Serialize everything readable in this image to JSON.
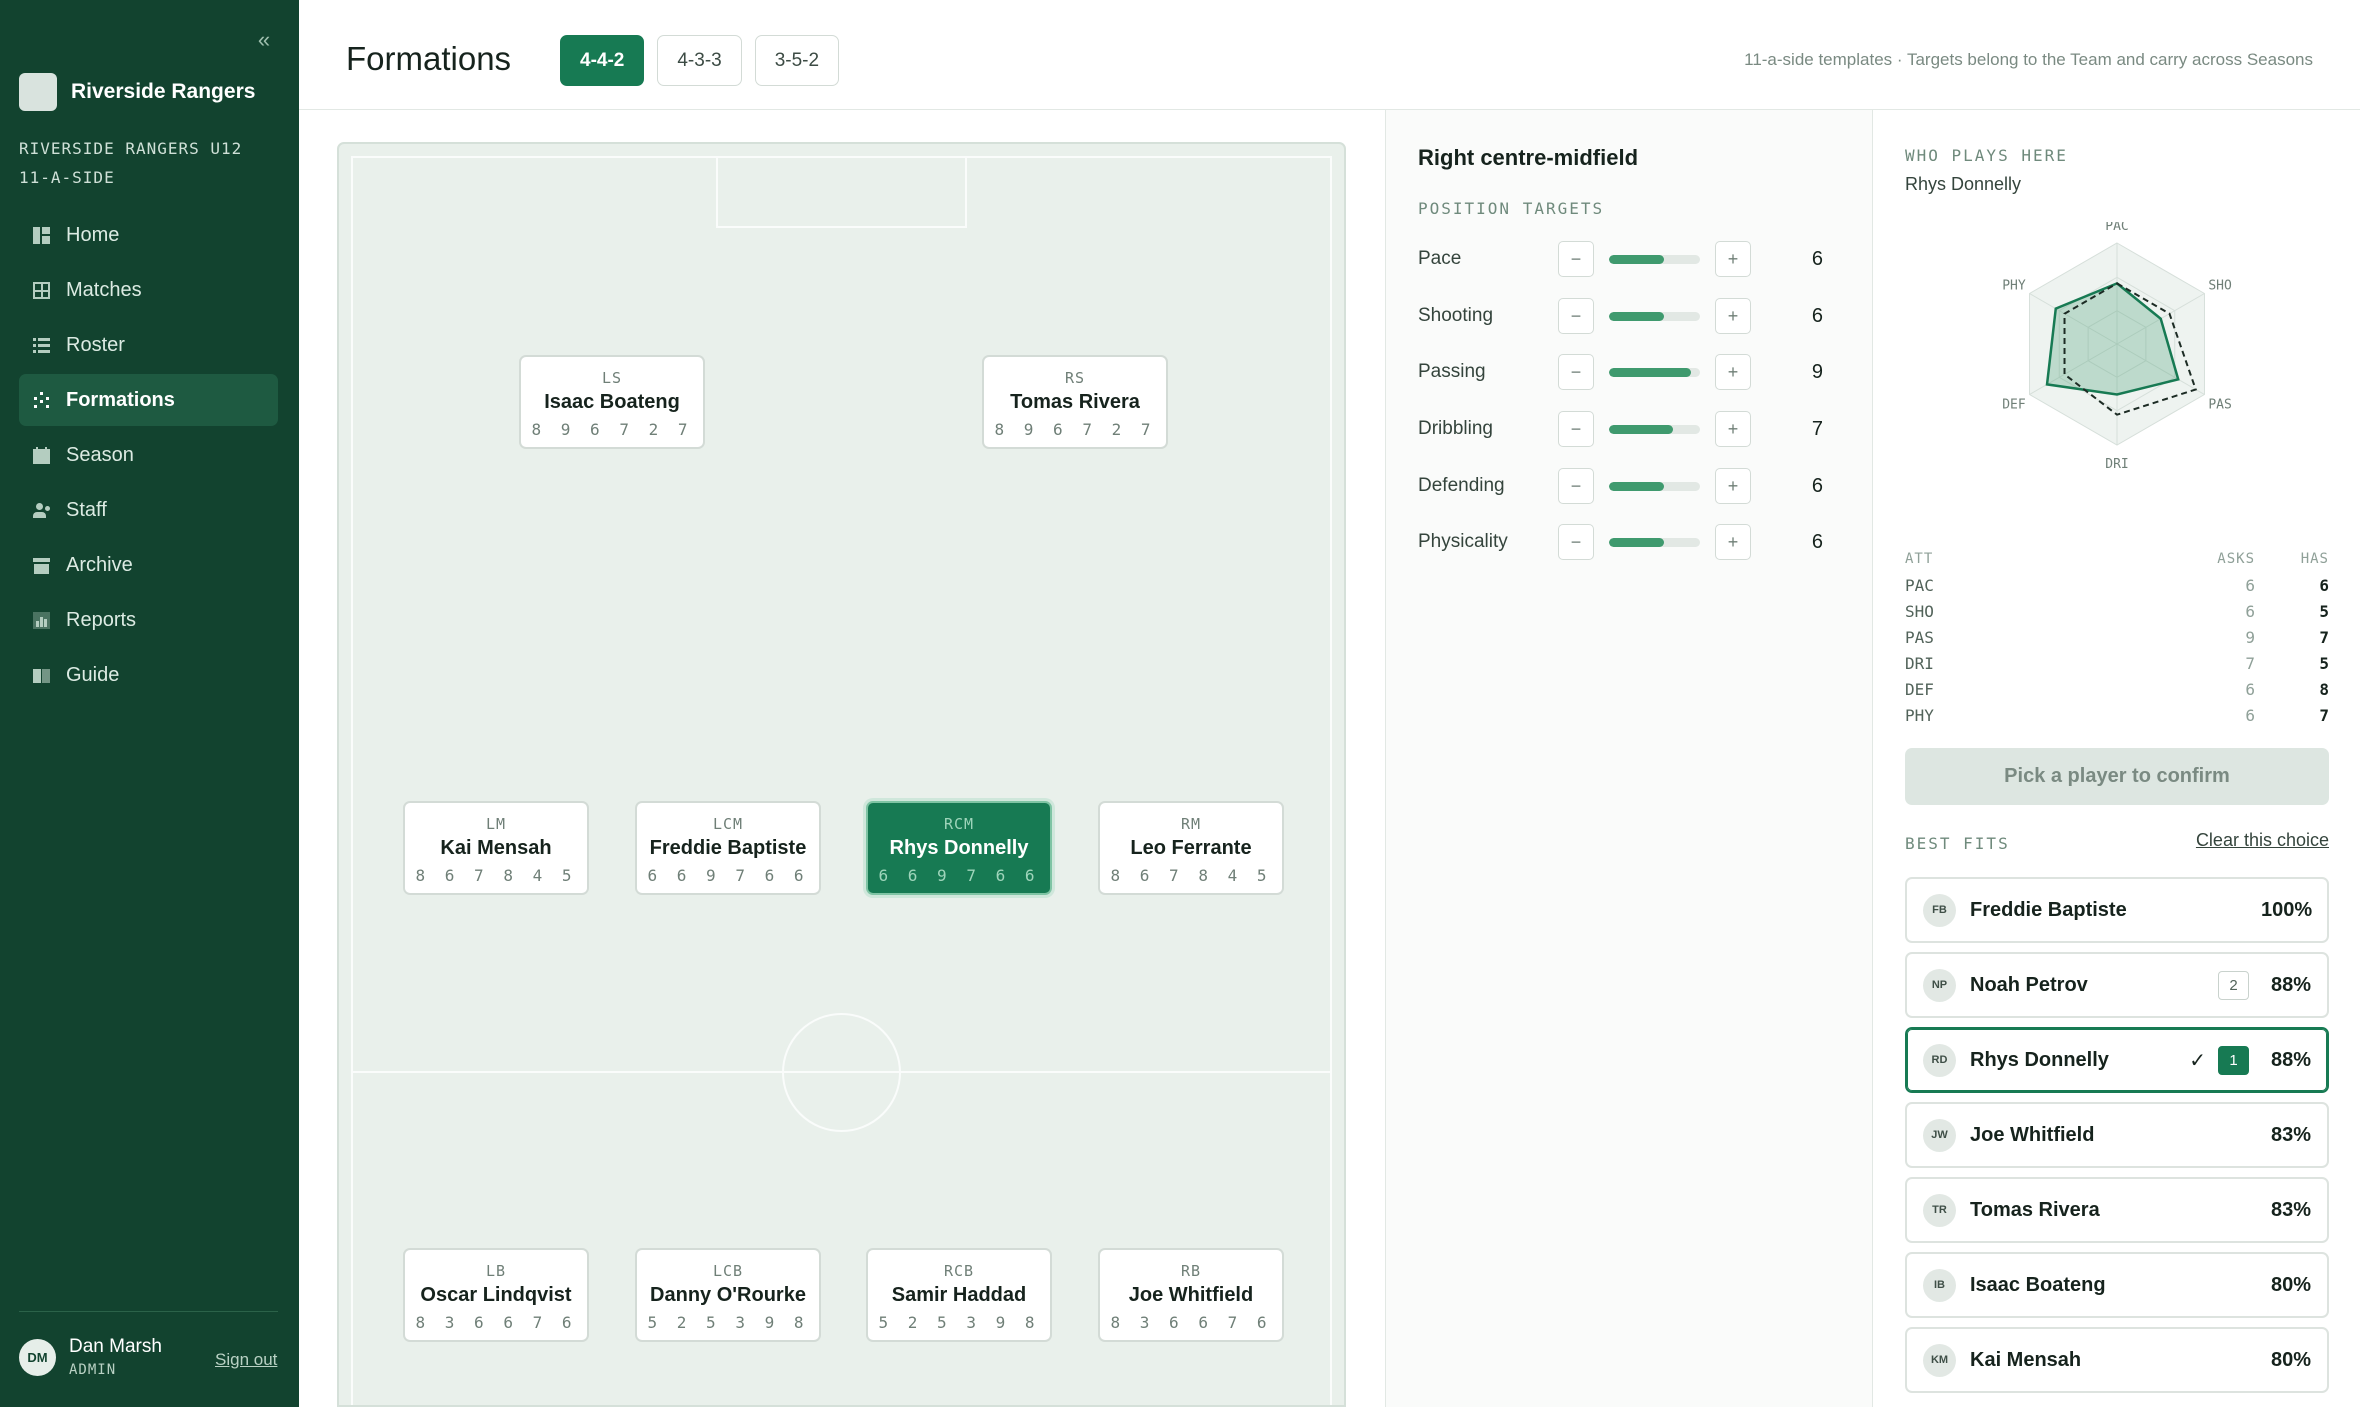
{
  "sidebar": {
    "collapse_icon": "double-chevron-left-icon",
    "brand_name": "Riverside Rangers",
    "team_line1": "RIVERSIDE RANGERS U12",
    "team_line2": "11-A-SIDE",
    "items": [
      {
        "label": "Home",
        "icon": "home-icon"
      },
      {
        "label": "Matches",
        "icon": "matches-icon"
      },
      {
        "label": "Roster",
        "icon": "roster-icon"
      },
      {
        "label": "Formations",
        "icon": "formations-icon",
        "active": true
      },
      {
        "label": "Season",
        "icon": "calendar-icon"
      },
      {
        "label": "Staff",
        "icon": "staff-icon"
      },
      {
        "label": "Archive",
        "icon": "archive-icon"
      },
      {
        "label": "Reports",
        "icon": "reports-icon"
      },
      {
        "label": "Guide",
        "icon": "guide-icon"
      }
    ],
    "user": {
      "initials": "DM",
      "name": "Dan Marsh",
      "role": "ADMIN",
      "signout": "Sign out"
    }
  },
  "header": {
    "title": "Formations",
    "tabs": [
      {
        "label": "4-4-2",
        "active": true
      },
      {
        "label": "4-3-3"
      },
      {
        "label": "3-5-2"
      }
    ],
    "note": "11-a-side templates · Targets belong to the Team and carry across Seasons"
  },
  "pitch": {
    "positions": [
      {
        "code": "LS",
        "name": "Isaac Boateng",
        "stats": "8 9 6 7 2 7"
      },
      {
        "code": "RS",
        "name": "Tomas Rivera",
        "stats": "8 9 6 7 2 7"
      },
      {
        "code": "LM",
        "name": "Kai Mensah",
        "stats": "8 6 7 8 4 5"
      },
      {
        "code": "LCM",
        "name": "Freddie Baptiste",
        "stats": "6 6 9 7 6 6"
      },
      {
        "code": "RCM",
        "name": "Rhys Donnelly",
        "stats": "6 6 9 7 6 6",
        "selected": true
      },
      {
        "code": "RM",
        "name": "Leo Ferrante",
        "stats": "8 6 7 8 4 5"
      },
      {
        "code": "LB",
        "name": "Oscar Lindqvist",
        "stats": "8 3 6 6 7 6"
      },
      {
        "code": "LCB",
        "name": "Danny O'Rourke",
        "stats": "5 2 5 3 9 8"
      },
      {
        "code": "RCB",
        "name": "Samir Haddad",
        "stats": "5 2 5 3 9 8"
      },
      {
        "code": "RB",
        "name": "Joe Whitfield",
        "stats": "8 3 6 6 7 6"
      }
    ]
  },
  "targets": {
    "title": "Right centre-midfield",
    "section": "POSITION TARGETS",
    "minus": "−",
    "plus": "+",
    "max": 10,
    "rows": [
      {
        "label": "Pace",
        "value": 6
      },
      {
        "label": "Shooting",
        "value": 6
      },
      {
        "label": "Passing",
        "value": 9
      },
      {
        "label": "Dribbling",
        "value": 7
      },
      {
        "label": "Defending",
        "value": 6
      },
      {
        "label": "Physicality",
        "value": 6
      }
    ]
  },
  "who": {
    "label": "WHO PLAYS HERE",
    "player": "Rhys Donnelly",
    "radar_axes": [
      "PAC",
      "SHO",
      "PAS",
      "DRI",
      "DEF",
      "PHY"
    ],
    "asks": [
      6,
      6,
      9,
      7,
      6,
      6
    ],
    "has": [
      6,
      5,
      7,
      5,
      8,
      7
    ],
    "table_head": {
      "att": "ATT",
      "asks": "ASKS",
      "has": "HAS"
    },
    "rows": [
      {
        "att": "PAC",
        "asks": "6",
        "has": "6"
      },
      {
        "att": "SHO",
        "asks": "6",
        "has": "5"
      },
      {
        "att": "PAS",
        "asks": "9",
        "has": "7"
      },
      {
        "att": "DRI",
        "asks": "7",
        "has": "5"
      },
      {
        "att": "DEF",
        "asks": "6",
        "has": "8"
      },
      {
        "att": "PHY",
        "asks": "6",
        "has": "7"
      }
    ],
    "confirm": "Pick a player to confirm"
  },
  "best_fits": {
    "label": "BEST FITS",
    "clear": "Clear this choice",
    "items": [
      {
        "initials": "FB",
        "name": "Freddie Baptiste",
        "rank": "",
        "pct": "100%"
      },
      {
        "initials": "NP",
        "name": "Noah Petrov",
        "rank": "2",
        "pct": "88%"
      },
      {
        "initials": "RD",
        "name": "Rhys Donnelly",
        "rank": "1",
        "check": "✓",
        "pct": "88%",
        "current": true
      },
      {
        "initials": "JW",
        "name": "Joe Whitfield",
        "rank": "",
        "pct": "83%"
      },
      {
        "initials": "TR",
        "name": "Tomas Rivera",
        "rank": "",
        "pct": "83%"
      },
      {
        "initials": "IB",
        "name": "Isaac Boateng",
        "rank": "",
        "pct": "80%"
      },
      {
        "initials": "KM",
        "name": "Kai Mensah",
        "rank": "",
        "pct": "80%"
      }
    ]
  }
}
